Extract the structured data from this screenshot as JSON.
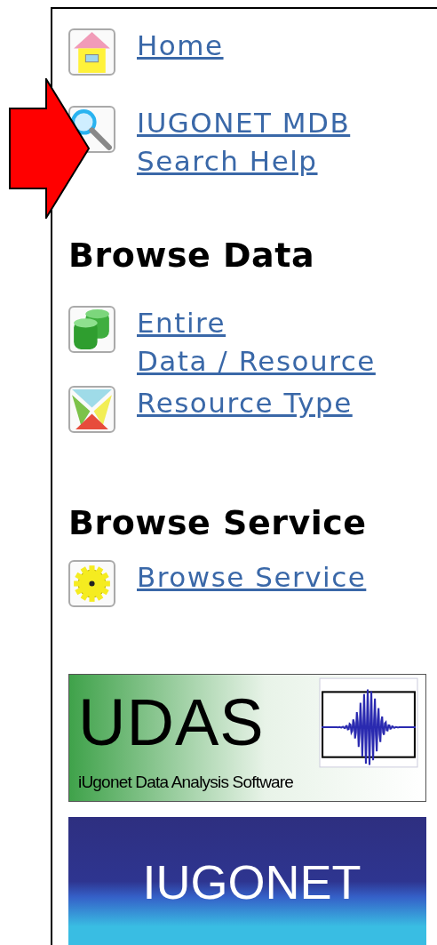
{
  "sections": [
    {
      "items": [
        {
          "kind": "house",
          "lines": [
            "Home"
          ]
        },
        {
          "kind": "magnifier",
          "lines": [
            "IUGONET MDB",
            "Search Help"
          ]
        }
      ]
    },
    {
      "heading": "Browse Data",
      "items": [
        {
          "kind": "database",
          "lines": [
            "Entire",
            "Data / Resource"
          ]
        },
        {
          "kind": "triangles",
          "lines": [
            "Resource Type"
          ]
        }
      ]
    },
    {
      "heading": "Browse Service",
      "items": [
        {
          "kind": "gear",
          "lines": [
            "Browse Service"
          ]
        }
      ]
    }
  ],
  "banners": [
    {
      "kind": "udas",
      "title": "UDAS",
      "subtitle": "iUgonet Data Analysis Software"
    },
    {
      "kind": "iugonet",
      "title": "IUGONET"
    }
  ],
  "pointer": {
    "kind": "arrow"
  }
}
